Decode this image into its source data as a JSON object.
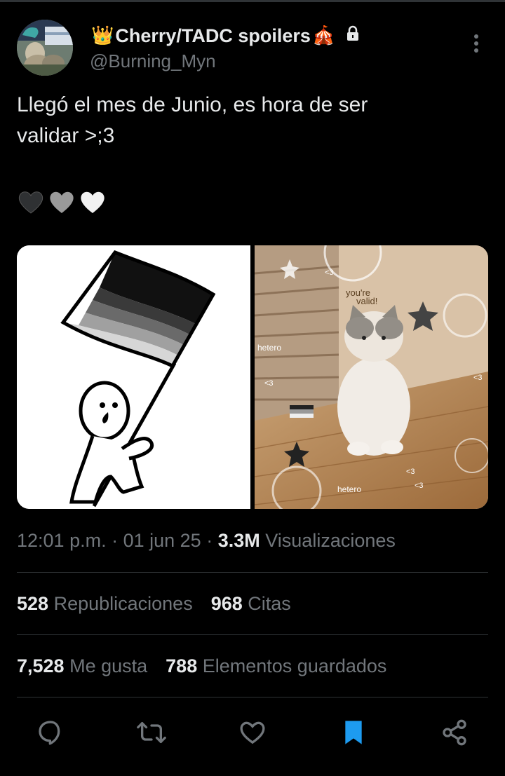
{
  "author": {
    "crown_emoji": "👑",
    "display_name": "Cherry/TADC spoilers",
    "tent_emoji": "🎪",
    "handle": "@Burning_Myn"
  },
  "tweet": {
    "line1": "Llegó el mes de Junio, es hora de ser",
    "line2": "validar >;3",
    "hearts": [
      "🖤",
      "🩶",
      "🤍"
    ],
    "media": [
      {
        "description_icon": "flag-person-drawing"
      },
      {
        "overlay_texts": [
          "<3",
          "you're",
          "valid!",
          "hetero",
          "<3",
          "<3",
          "hetero",
          "<3",
          "<3"
        ]
      }
    ]
  },
  "meta": {
    "time": "12:01 p.m.",
    "date": "01 jun 25",
    "views": "3.3M",
    "views_label": "Visualizaciones"
  },
  "stats": {
    "reposts": "528",
    "reposts_label": "Republicaciones",
    "quotes": "968",
    "quotes_label": "Citas",
    "likes": "7,528",
    "likes_label": "Me gusta",
    "bookmarks": "788",
    "bookmarks_label": "Elementos guardados"
  },
  "colors": {
    "background": "#000000",
    "text": "#e7e9ea",
    "muted": "#71767b",
    "divider": "#2f3336",
    "accent": "#1d9bf0"
  },
  "icons": [
    "lock-icon",
    "more-icon",
    "reply-icon",
    "repost-icon",
    "like-icon",
    "bookmark-icon",
    "share-icon"
  ]
}
